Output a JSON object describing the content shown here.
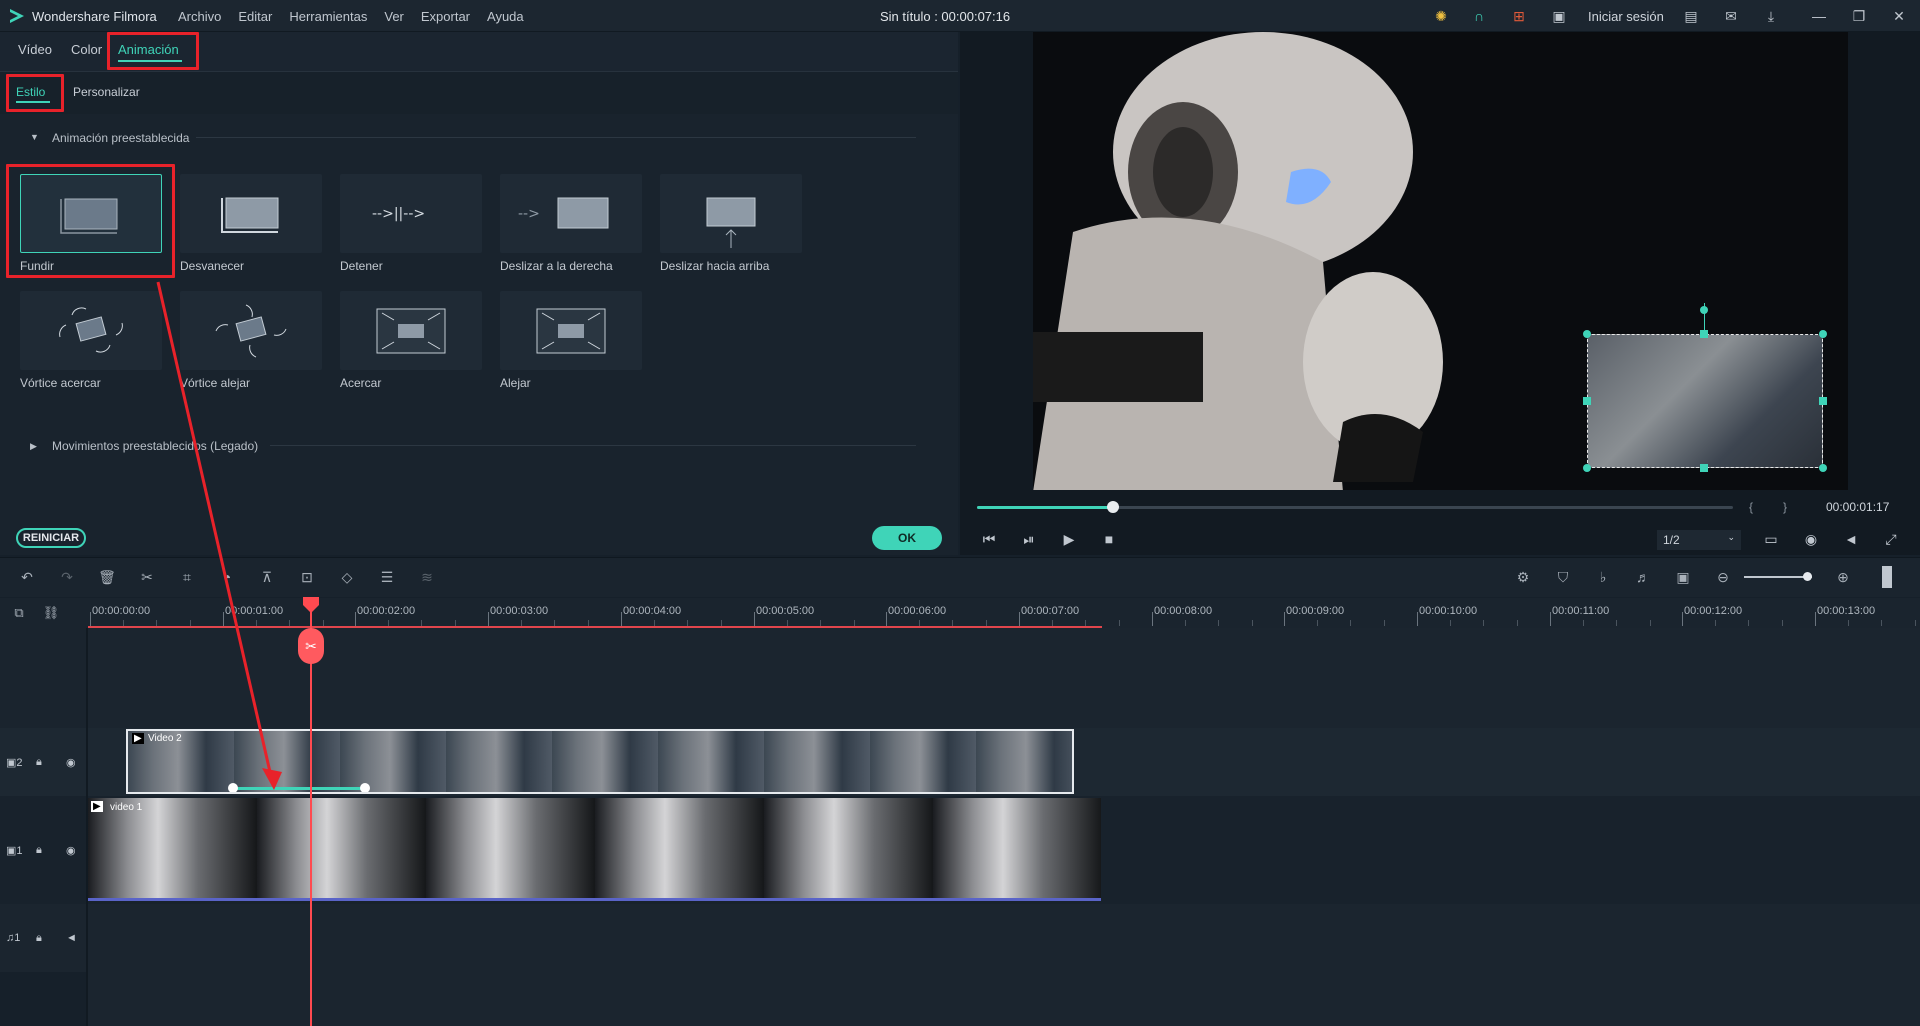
{
  "titlebar": {
    "app_name": "Wondershare Filmora",
    "menu": [
      "Archivo",
      "Editar",
      "Herramientas",
      "Ver",
      "Exportar",
      "Ayuda"
    ],
    "document_title": "Sin título : 00:00:07:16",
    "sign_in": "Iniciar sesión",
    "icons": [
      "bulb-icon",
      "headset-icon",
      "cart-icon",
      "gift-icon",
      "save-icon",
      "mail-icon",
      "download-icon",
      "minimize-icon",
      "restore-icon",
      "close-icon"
    ],
    "accent": "#3fd4b8"
  },
  "edit_panel": {
    "tabs": [
      "Vídeo",
      "Color",
      "Animación"
    ],
    "active_tab": "Animación",
    "subtabs": [
      "Estilo",
      "Personalizar"
    ],
    "active_subtab": "Estilo",
    "section_presets": "Animación preestablecida",
    "section_legacy": "Movimientos preestablecidos (Legado)",
    "presets": [
      {
        "label": "Fundir",
        "icon": "fade-in-icon"
      },
      {
        "label": "Desvanecer",
        "icon": "fade-out-icon"
      },
      {
        "label": "Detener",
        "icon": "stop-motion-icon"
      },
      {
        "label": "Deslizar a la derecha",
        "icon": "slide-right-icon"
      },
      {
        "label": "Deslizar hacia arriba",
        "icon": "slide-up-icon"
      },
      {
        "label": "Vórtice acercar",
        "icon": "vortex-in-icon"
      },
      {
        "label": "Vórtice alejar",
        "icon": "vortex-out-icon"
      },
      {
        "label": "Acercar",
        "icon": "zoom-in-icon"
      },
      {
        "label": "Alejar",
        "icon": "zoom-out-icon"
      }
    ],
    "selected_preset": "Fundir",
    "reset_label": "REINICIAR",
    "ok_label": "OK"
  },
  "preview": {
    "timecode": "00:00:01:17",
    "quality": "1/2",
    "progress": 0.18
  },
  "timeline": {
    "ruler_labels": [
      "00:00:00:00",
      "00:00:01:00",
      "00:00:02:00",
      "00:00:03:00",
      "00:00:04:00",
      "00:00:05:00",
      "00:00:06:00",
      "00:00:07:00",
      "00:00:08:00",
      "00:00:09:00",
      "00:00:10:00",
      "00:00:11:00",
      "00:00:12:00",
      "00:00:13:00"
    ],
    "tracks": [
      {
        "id": "2",
        "clip_label": "Video 2"
      },
      {
        "id": "1",
        "clip_label": "video 1"
      },
      {
        "id": "1",
        "type": "audio"
      }
    ]
  }
}
